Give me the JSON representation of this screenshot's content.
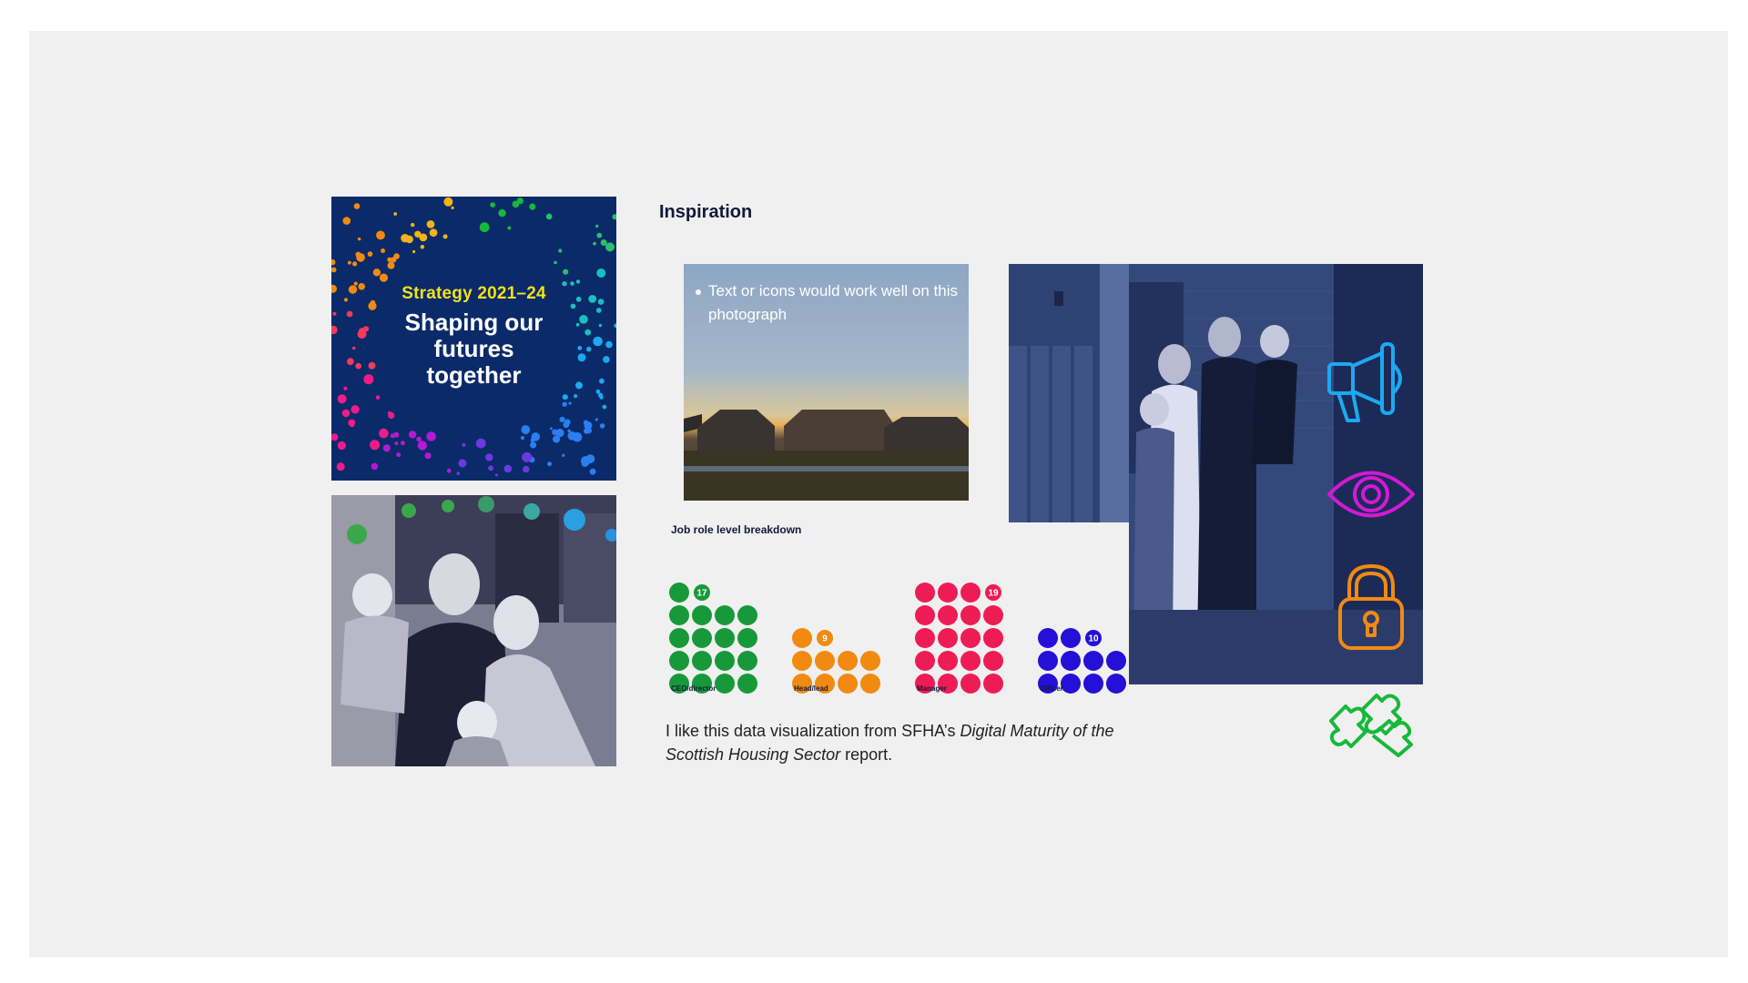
{
  "heading": "Inspiration",
  "cover": {
    "year": "Strategy 2021–24",
    "title_lines": [
      "Shaping our",
      "futures",
      "together"
    ]
  },
  "sky_photo": {
    "caption": "Text or icons would work well on this photograph"
  },
  "chart_data": {
    "type": "dot",
    "title": "Job role level breakdown",
    "categories": [
      "CEO/director",
      "Head/lead",
      "Manager",
      "Officer"
    ],
    "values": [
      17,
      9,
      19,
      10
    ],
    "colors": [
      "#17993a",
      "#f28a12",
      "#ee1c55",
      "#2410d6"
    ]
  },
  "quote": {
    "prefix": "I like this data visualization from SFHA’s ",
    "title": "Digital Maturity of the Scottish Housing Sector",
    "suffix": " report."
  },
  "icons": [
    {
      "name": "megaphone-icon",
      "color": "#1ea8f0"
    },
    {
      "name": "eye-icon",
      "color": "#d21ad4"
    },
    {
      "name": "padlock-icon",
      "color": "#f28a12"
    },
    {
      "name": "puzzle-icon",
      "color": "#17b93a"
    }
  ]
}
